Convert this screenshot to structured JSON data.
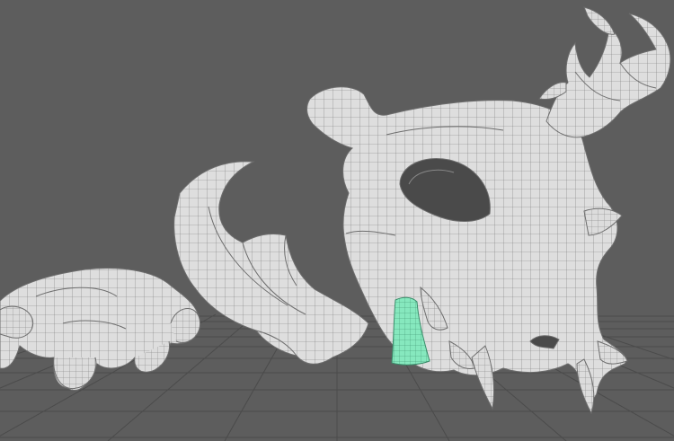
{
  "viewport": {
    "view": "perspective",
    "background_color": "#5d5d5d",
    "grid_color": "#4a4a4a",
    "mesh_color": "#dcdcdc",
    "wire_color": "#6a6a6a",
    "selected_face_color": "#7fe6b9"
  },
  "objects": [
    {
      "name": "hand-claw-mesh"
    },
    {
      "name": "jaw-mesh"
    },
    {
      "name": "skull-mesh"
    },
    {
      "name": "antler-mesh"
    },
    {
      "name": "selected-tooth-faces"
    }
  ]
}
